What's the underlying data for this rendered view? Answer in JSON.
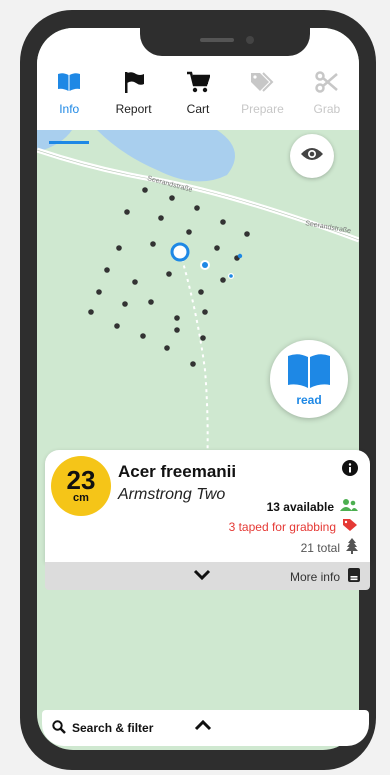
{
  "nav": {
    "items": [
      {
        "label": "Info",
        "icon": "book-icon",
        "state": "active"
      },
      {
        "label": "Report",
        "icon": "flag-icon",
        "state": "normal"
      },
      {
        "label": "Cart",
        "icon": "cart-icon",
        "state": "normal"
      },
      {
        "label": "Prepare",
        "icon": "tags-icon",
        "state": "disabled"
      },
      {
        "label": "Grab",
        "icon": "scissors-icon",
        "state": "disabled"
      }
    ]
  },
  "map": {
    "road_label_1": "Seerandstraße",
    "road_label_2": "Seerandstraße"
  },
  "read_button": {
    "label": "read"
  },
  "card": {
    "size_value": "23",
    "size_unit": "cm",
    "species": "Acer freemanii",
    "cultivar": "Armstrong Two",
    "available": "13 available",
    "taped": "3 taped for grabbing",
    "total": "21 total"
  },
  "footer": {
    "more_info": "More info"
  },
  "search": {
    "label": "Search & filter"
  },
  "colors": {
    "accent": "#1e88e5",
    "badge": "#f5c518",
    "available": "#4caf50",
    "taped": "#e53935",
    "map_bg": "#cfe8d0",
    "water": "#a9cfee"
  }
}
